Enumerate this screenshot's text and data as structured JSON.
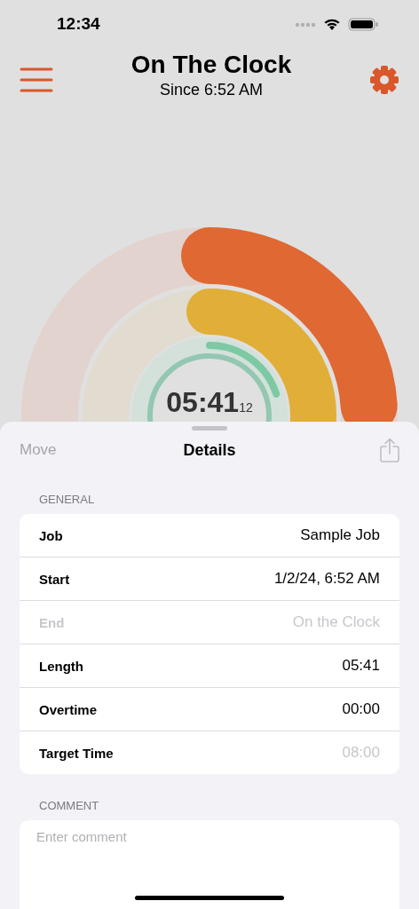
{
  "status_bar": {
    "time": "12:34"
  },
  "header": {
    "title": "On The Clock",
    "subtitle": "Since 6:52 AM"
  },
  "gauge": {
    "rings": [
      {
        "kind": "outer",
        "level": 0.24,
        "color": "#df6833"
      },
      {
        "kind": "middle",
        "level": 0.27,
        "color": "#e1ae38"
      },
      {
        "kind": "inner",
        "level": 0.2,
        "color": "#7cc9a4"
      }
    ],
    "time": "05:41",
    "seconds": "12"
  },
  "sheet": {
    "left_action": {
      "label": "Move",
      "disabled": true
    },
    "title": "Details",
    "share_disabled": true
  },
  "sections": [
    {
      "header": "GENERAL",
      "rows": [
        {
          "label": "Job",
          "value": "Sample Job",
          "disabled": false,
          "value_muted": false
        },
        {
          "label": "Start",
          "value": "1/2/24, 6:52 AM",
          "disabled": false,
          "value_muted": false
        },
        {
          "label": "End",
          "value": "On the Clock",
          "disabled": true,
          "value_muted": true
        },
        {
          "label": "Length",
          "value": "05:41",
          "disabled": false,
          "value_muted": false
        },
        {
          "label": "Overtime",
          "value": "00:00",
          "disabled": false,
          "value_muted": false
        },
        {
          "label": "Target Time",
          "value": "08:00",
          "disabled": false,
          "value_muted": true
        }
      ]
    },
    {
      "header": "COMMENT",
      "placeholder": "Enter comment"
    }
  ]
}
